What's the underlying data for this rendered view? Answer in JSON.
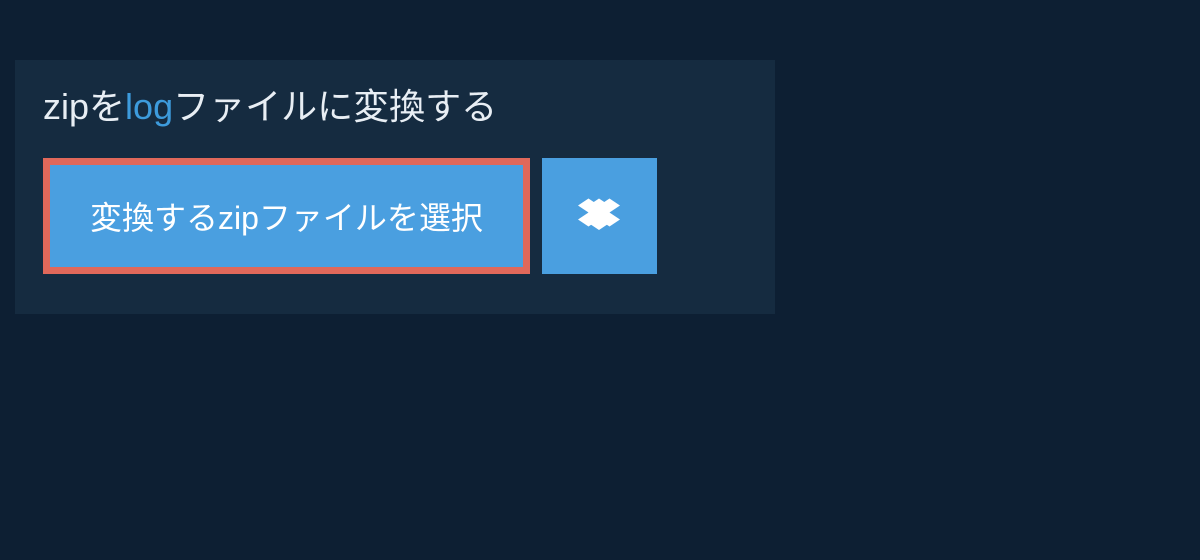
{
  "heading": {
    "prefix": "zip",
    "separator": "を",
    "to_format": "log",
    "suffix": "ファイルに変換する"
  },
  "select_button_label": "変換するzipファイルを選択",
  "colors": {
    "background": "#0d1f33",
    "panel": "#152b40",
    "button": "#4a9fe0",
    "highlight_border": "#e0685a",
    "accent": "#3d9bdc"
  }
}
